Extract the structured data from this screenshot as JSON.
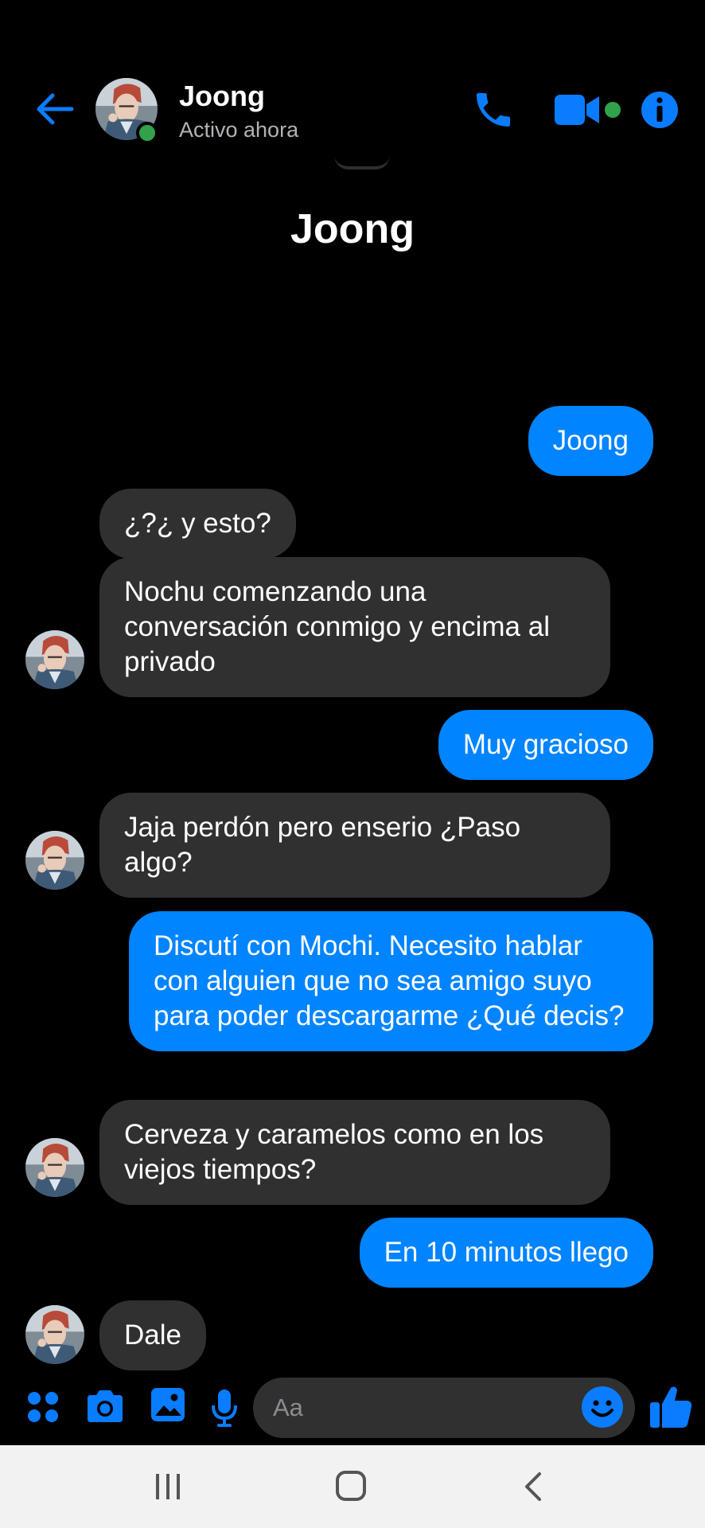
{
  "header": {
    "contact_name": "Joong",
    "status": "Activo ahora"
  },
  "conversation": {
    "title": "Joong"
  },
  "messages": [
    {
      "direction": "outgoing",
      "text": "Joong"
    },
    {
      "direction": "incoming",
      "text": "¿?¿ y esto?"
    },
    {
      "direction": "incoming",
      "text": "Nochu comenzando una conversación conmigo y encima al privado"
    },
    {
      "direction": "outgoing",
      "text": "Muy gracioso"
    },
    {
      "direction": "incoming",
      "text": "Jaja perdón pero enserio ¿Paso algo?"
    },
    {
      "direction": "outgoing",
      "text": "Discutí con Mochi. Necesito hablar con alguien que no sea amigo suyo para poder descargarme ¿Qué decis?"
    },
    {
      "direction": "incoming",
      "text": "Cerveza y caramelos como en los viejos tiempos?"
    },
    {
      "direction": "outgoing",
      "text": "En 10 minutos llego"
    },
    {
      "direction": "incoming",
      "text": "Dale"
    }
  ],
  "composer": {
    "placeholder": "Aa"
  },
  "colors": {
    "accent": "#0084ff",
    "outgoing_bubble": "#0084ff",
    "incoming_bubble": "#303030",
    "online": "#31a24c",
    "background": "#000000",
    "nav_bar": "#f2f2f2"
  },
  "icons": {
    "header": [
      "back-arrow-icon",
      "phone-icon",
      "video-camera-icon",
      "info-icon"
    ],
    "composer": [
      "apps-icon",
      "camera-icon",
      "gallery-icon",
      "microphone-icon",
      "emoji-icon",
      "thumbs-up-icon"
    ],
    "system_nav": [
      "recent-apps-icon",
      "home-icon",
      "back-icon"
    ]
  }
}
